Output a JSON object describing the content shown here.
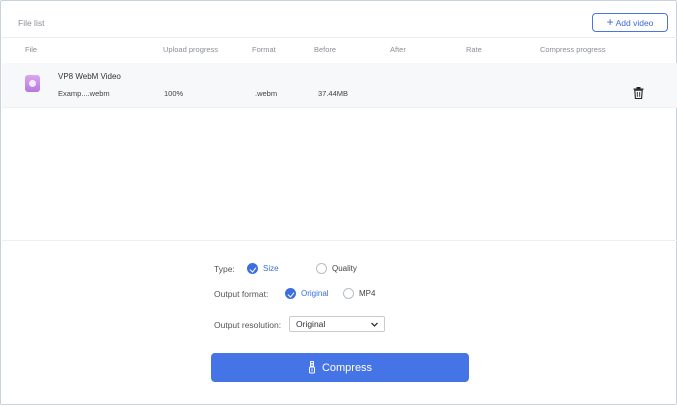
{
  "header": {
    "title": "File list",
    "add_video_label": "Add video"
  },
  "columns": [
    "File",
    "Upload progress",
    "Format",
    "Before",
    "After",
    "Rate",
    "Compress progress"
  ],
  "files": [
    {
      "type_label": "VP8 WebM Video",
      "name": "Examp....webm",
      "upload_progress": "100%",
      "format": ".webm",
      "before": "37.44MB",
      "after": "",
      "rate": "",
      "compress_progress": ""
    }
  ],
  "options": {
    "type_label": "Type:",
    "type_choices": [
      {
        "label": "Size",
        "selected": true
      },
      {
        "label": "Quality",
        "selected": false
      }
    ],
    "format_label": "Output format:",
    "format_choices": [
      {
        "label": "Original",
        "selected": true
      },
      {
        "label": "MP4",
        "selected": false
      }
    ],
    "resolution_label": "Output resolution:",
    "resolution_value": "Original"
  },
  "actions": {
    "compress_label": "Compress"
  },
  "colors": {
    "accent": "#4574e6",
    "border": "#c9d2dc"
  }
}
